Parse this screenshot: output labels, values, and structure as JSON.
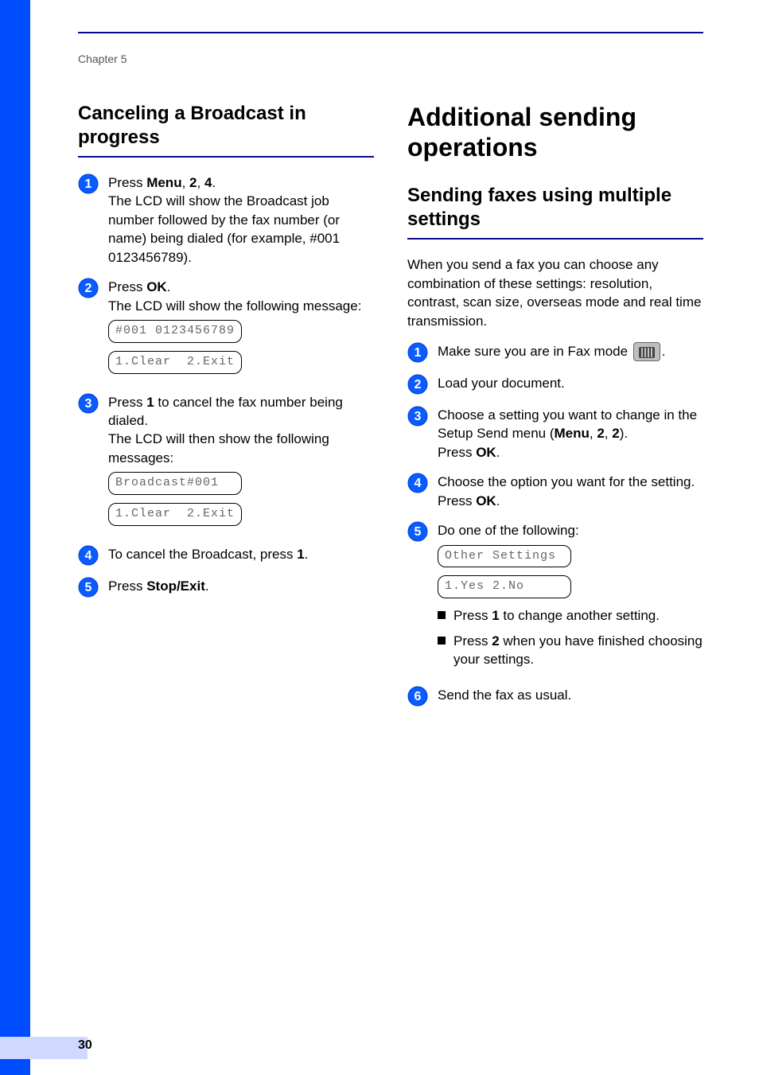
{
  "chapter": "Chapter 5",
  "page_number": "30",
  "left": {
    "heading": "Canceling a Broadcast in progress",
    "steps": [
      {
        "n": "1",
        "segments": [
          {
            "t": "Press "
          },
          {
            "t": "Menu",
            "b": true
          },
          {
            "t": ", "
          },
          {
            "t": "2",
            "b": true
          },
          {
            "t": ", "
          },
          {
            "t": "4",
            "b": true
          },
          {
            "t": "."
          },
          {
            "br": true
          },
          {
            "t": "The LCD will show the Broadcast job number followed by the fax number (or name) being dialed (for example, #001 0123456789)."
          }
        ]
      },
      {
        "n": "2",
        "segments": [
          {
            "t": "Press "
          },
          {
            "t": "OK",
            "b": true
          },
          {
            "t": "."
          },
          {
            "br": true
          },
          {
            "t": "The LCD will show the following message:"
          }
        ],
        "lcd": [
          "#001 0123456789",
          "1.Clear  2.Exit"
        ]
      },
      {
        "n": "3",
        "segments": [
          {
            "t": "Press "
          },
          {
            "t": "1",
            "b": true
          },
          {
            "t": " to cancel the fax number being dialed."
          },
          {
            "br": true
          },
          {
            "t": "The LCD will then show the following messages:"
          }
        ],
        "lcd": [
          "Broadcast#001",
          "1.Clear  2.Exit"
        ]
      },
      {
        "n": "4",
        "segments": [
          {
            "t": "To cancel the Broadcast, press "
          },
          {
            "t": "1",
            "b": true
          },
          {
            "t": "."
          }
        ]
      },
      {
        "n": "5",
        "segments": [
          {
            "t": "Press "
          },
          {
            "t": "Stop/Exit",
            "b": true
          },
          {
            "t": "."
          }
        ]
      }
    ]
  },
  "right": {
    "title": "Additional sending operations",
    "heading": "Sending faxes using multiple settings",
    "intro": "When you send a fax you can choose any combination of these settings: resolution, contrast, scan size, overseas mode and real time transmission.",
    "steps": [
      {
        "n": "1",
        "segments": [
          {
            "t": "Make sure you are in Fax mode "
          },
          {
            "icon": "fax"
          },
          {
            "t": "."
          }
        ]
      },
      {
        "n": "2",
        "segments": [
          {
            "t": "Load your document."
          }
        ]
      },
      {
        "n": "3",
        "segments": [
          {
            "t": "Choose a setting you want to change in the Setup Send menu ("
          },
          {
            "t": "Menu",
            "b": true
          },
          {
            "t": ", "
          },
          {
            "t": "2",
            "b": true
          },
          {
            "t": ", "
          },
          {
            "t": "2",
            "b": true
          },
          {
            "t": ")."
          },
          {
            "br": true
          },
          {
            "t": "Press "
          },
          {
            "t": "OK",
            "b": true
          },
          {
            "t": "."
          }
        ]
      },
      {
        "n": "4",
        "segments": [
          {
            "t": "Choose the option you want for the setting."
          },
          {
            "br": true
          },
          {
            "t": "Press "
          },
          {
            "t": "OK",
            "b": true
          },
          {
            "t": "."
          }
        ]
      },
      {
        "n": "5",
        "segments": [
          {
            "t": "Do one of the following:"
          }
        ],
        "lcd": [
          "Other Settings",
          "1.Yes 2.No"
        ],
        "sublist": [
          [
            {
              "t": "Press "
            },
            {
              "t": "1",
              "b": true
            },
            {
              "t": " to change another setting."
            }
          ],
          [
            {
              "t": "Press "
            },
            {
              "t": "2",
              "b": true
            },
            {
              "t": " when you have finished choosing your settings."
            }
          ]
        ]
      },
      {
        "n": "6",
        "segments": [
          {
            "t": "Send the fax as usual."
          }
        ]
      }
    ]
  }
}
